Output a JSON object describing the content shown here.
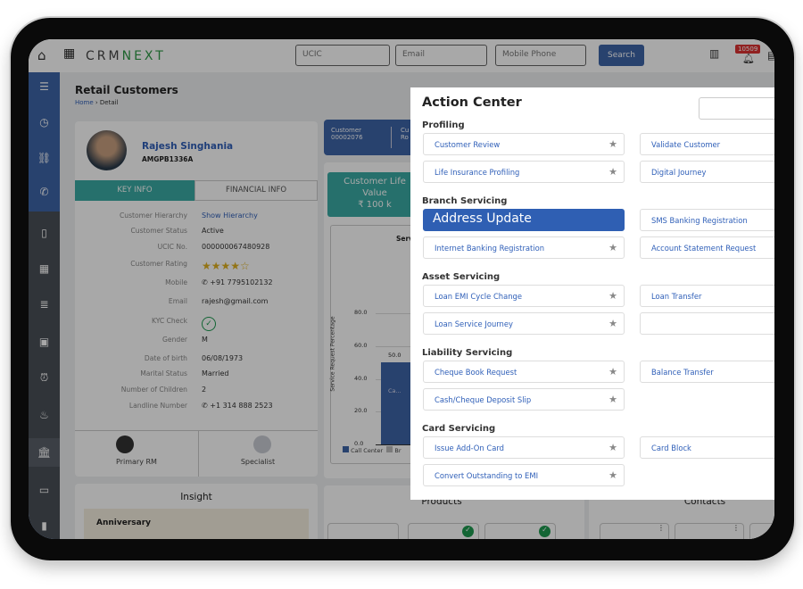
{
  "app": {
    "logo_a": "CRM",
    "logo_b": "NEXT",
    "search_fields": [
      "UCIC",
      "Email",
      "Mobile Phone"
    ],
    "search_label": "Search",
    "notification_count": "10509"
  },
  "page": {
    "title": "Retail Customers",
    "breadcrumb": [
      "Home",
      "Detail"
    ]
  },
  "customer": {
    "name": "Rajesh Singhania",
    "pan": "AMGPB1336A",
    "tabs": [
      "KEY INFO",
      "FINANCIAL INFO"
    ],
    "rating": 4,
    "rating_max": 5,
    "fields": [
      {
        "label": "Customer Hierarchy",
        "value": "Show Hierarchy",
        "link": true
      },
      {
        "label": "Customer Status",
        "value": "Active"
      },
      {
        "label": "UCIC No.",
        "value": "000000067480928"
      },
      {
        "label": "Customer Rating",
        "value": "",
        "stars": true
      },
      {
        "label": "Mobile",
        "value": "+91 7795102132",
        "phone": true
      },
      {
        "label": "Email",
        "value": "rajesh@gmail.com"
      },
      {
        "label": "KYC Check",
        "value": "",
        "check": true
      },
      {
        "label": "Gender",
        "value": "M"
      },
      {
        "label": "Date of birth",
        "value": "06/08/1973"
      },
      {
        "label": "Marital Status",
        "value": "Married"
      },
      {
        "label": "Number of Children",
        "value": "2"
      },
      {
        "label": "Landline Number",
        "value": "+1 314 888 2523",
        "phone": true
      }
    ],
    "relations": [
      "Primary RM",
      "Specialist"
    ]
  },
  "summary": {
    "customer_label": "Customer",
    "customer_id": "00002076",
    "next_label": "Cu",
    "next_value": "Ro",
    "clv_line1": "Customer Life",
    "clv_line2": "Value",
    "clv_value": "₹ 100 k"
  },
  "chart": {
    "title": "Serv",
    "ylabel": "Service Request Percentage",
    "yticks": [
      "80.0",
      "60.0",
      "40.0",
      "20.0",
      "0.0"
    ],
    "ylim": [
      0,
      80
    ],
    "bar_value": 50,
    "bar_value_label": "50.0",
    "bar_label": "Ca...",
    "legend": [
      "Call Center",
      "Br"
    ],
    "colors": {
      "call_center": "#3d64a8",
      "branch": "#bbbbbb"
    }
  },
  "sections": {
    "insight": "Insight",
    "insight_sub": "Anniversary",
    "products": "Products",
    "contacts": "Contacts"
  },
  "action_center": {
    "title": "Action Center",
    "groups": [
      {
        "name": "Profiling",
        "rows": [
          [
            "Customer Review",
            "Validate Customer"
          ],
          [
            "Life Insurance Profiling",
            "Digital Journey"
          ]
        ]
      },
      {
        "name": "Branch Servicing",
        "rows": [
          [
            "Address Update",
            "SMS Banking Registration"
          ],
          [
            "Internet Banking Registration",
            "Account Statement Request"
          ]
        ]
      },
      {
        "name": "Asset Servicing",
        "rows": [
          [
            "Loan EMI Cycle Change",
            "Loan Transfer"
          ],
          [
            "Loan Service Journey",
            ""
          ]
        ]
      },
      {
        "name": "Liability Servicing",
        "rows": [
          [
            "Cheque Book Request",
            "Balance Transfer"
          ],
          [
            "Cash/Cheque Deposit Slip",
            null
          ]
        ]
      },
      {
        "name": "Card Servicing",
        "rows": [
          [
            "Issue Add-On Card",
            "Card Block"
          ],
          [
            "Convert Outstanding to EMI",
            null
          ]
        ]
      }
    ],
    "highlighted": "Address Update"
  }
}
